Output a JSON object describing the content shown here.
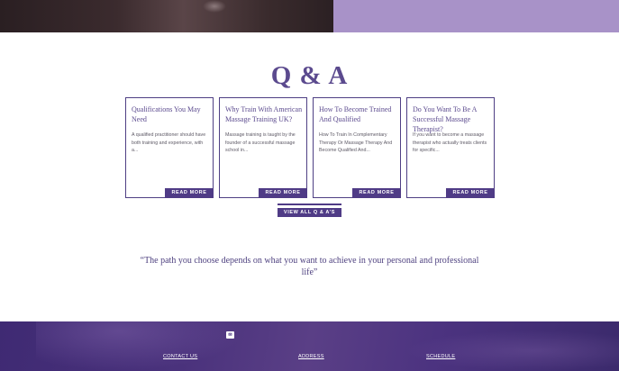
{
  "qa": {
    "title": "Q & A",
    "cards": [
      {
        "title": "Qualifications You May Need",
        "excerpt": "A qualified practitioner should have both training and experience, with a...",
        "button": "READ MORE"
      },
      {
        "title": "Why Train With American Massage Training UK?",
        "excerpt": "Massage training is taught by the founder of a successful massage school in...",
        "button": "READ MORE"
      },
      {
        "title": "How To Become Trained And Qualified",
        "excerpt": "How To Train In Complementary Therapy Or Massage Therapy And Become Qualified And...",
        "button": "READ MORE"
      },
      {
        "title": "Do You Want To Be A Successful Massage Therapist?",
        "excerpt": "If you want to become a massage therapist who actually treats clients for specific...",
        "button": "READ MORE"
      }
    ],
    "view_all": "VIEW ALL Q & A'S"
  },
  "quote": "“The path you choose depends on what you want to achieve in your personal and professional life”",
  "footer": {
    "icon": "envelope-icon",
    "links": [
      "CONTACT US",
      "ADDRESS",
      "SCHEDULE"
    ]
  },
  "colors": {
    "accent": "#a892c8",
    "brand": "#4f3b86",
    "heading": "#5b4a8e"
  }
}
